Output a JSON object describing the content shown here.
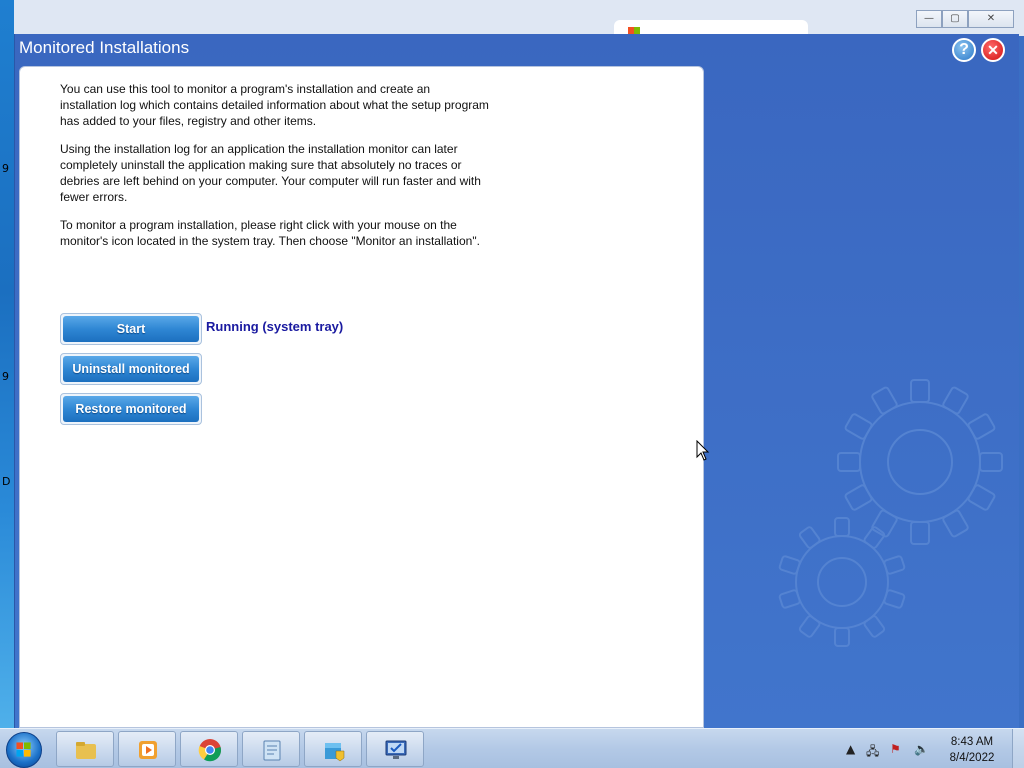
{
  "window": {
    "title": "Monitored Installations",
    "help_label": "?",
    "close_label": "✕"
  },
  "content": {
    "paragraph_1": "You can use this tool to monitor a program's installation and create an installation log which contains detailed information about what the setup program has added to your files, registry and other items.",
    "paragraph_2": "Using the installation log for an application the installation monitor can later completely uninstall the application making sure that absolutely no traces or debries are left behind on your computer. Your computer will run faster and with fewer errors.",
    "paragraph_3": "To monitor a program installation, please right click with your mouse on the monitor's icon located in the system tray. Then choose \"Monitor an installation\".",
    "status": "Running (system tray)"
  },
  "buttons": {
    "start": "Start",
    "uninstall_monitored": "Uninstall monitored",
    "restore_monitored": "Restore monitored"
  },
  "taskbar": {
    "time": "8:43 AM",
    "date": "8/4/2022"
  },
  "colors": {
    "window_background": "#3e6cc4",
    "button_blue": "#2f87d4",
    "status_text": "#1a1aa0"
  }
}
